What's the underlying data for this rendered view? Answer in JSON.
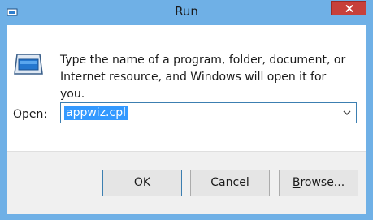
{
  "window": {
    "title": "Run",
    "frame_color": "#6fb0e6",
    "close_color": "#c7403a"
  },
  "content": {
    "message_line1": "Type the name of a program, folder, document, or",
    "message_line2": "Internet resource, and Windows will open it for you.",
    "open_label_mnemonic": "O",
    "open_label_rest": "pen:",
    "open_value": "appwiz.cpl"
  },
  "buttons": {
    "ok": "OK",
    "cancel": "Cancel",
    "browse_mnemonic": "B",
    "browse_rest": "rowse..."
  },
  "icons": {
    "app": "run-app-icon",
    "run": "run-program-icon",
    "close": "close-icon",
    "dropdown": "chevron-down-icon"
  }
}
